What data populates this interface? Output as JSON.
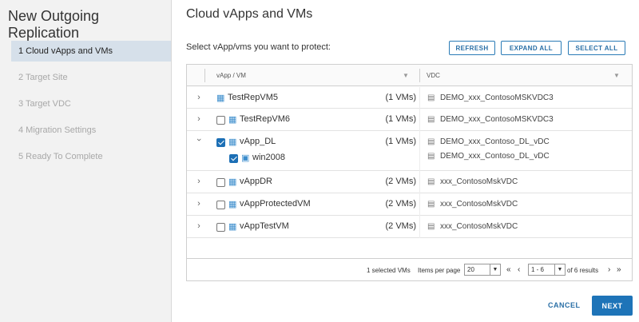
{
  "wizard": {
    "title": "New Outgoing Replication",
    "steps": [
      {
        "label": "1 Cloud vApps and VMs",
        "active": true
      },
      {
        "label": "2 Target Site",
        "active": false
      },
      {
        "label": "3 Target VDC",
        "active": false
      },
      {
        "label": "4 Migration Settings",
        "active": false
      },
      {
        "label": "5 Ready To Complete",
        "active": false
      }
    ]
  },
  "page": {
    "title": "Cloud vApps and VMs",
    "prompt": "Select vApp/vms you want to protect:",
    "buttons": {
      "refresh": "REFRESH",
      "expand_all": "EXPAND ALL",
      "select_all": "SELECT ALL"
    }
  },
  "grid": {
    "columns": {
      "vm": "vApp / VM",
      "vdc": "VDC"
    },
    "rows": [
      {
        "name": "TestRepVM5",
        "count": "(1 VMs)",
        "vdc": "DEMO_xxx_ContosoMSKVDC3",
        "expanded": false,
        "checkbox": false,
        "checked": false
      },
      {
        "name": "TestRepVM6",
        "count": "(1 VMs)",
        "vdc": "DEMO_xxx_ContosoMSKVDC3",
        "expanded": false,
        "checkbox": true,
        "checked": false
      },
      {
        "name": "vApp_DL",
        "count": "(1 VMs)",
        "vdc": "DEMO_xxx_Contoso_DL_vDC",
        "expanded": true,
        "checkbox": true,
        "checked": true,
        "children": [
          {
            "name": "win2008",
            "vdc": "DEMO_xxx_Contoso_DL_vDC",
            "checked": true
          }
        ]
      },
      {
        "name": "vAppDR",
        "count": "(2 VMs)",
        "vdc": "xxx_ContosoMskVDC",
        "expanded": false,
        "checkbox": true,
        "checked": false
      },
      {
        "name": "vAppProtectedVM",
        "count": "(2 VMs)",
        "vdc": "xxx_ContosoMskVDC",
        "expanded": false,
        "checkbox": true,
        "checked": false
      },
      {
        "name": "vAppTestVM",
        "count": "(2 VMs)",
        "vdc": "xxx_ContosoMskVDC",
        "expanded": false,
        "checkbox": true,
        "checked": false
      }
    ],
    "footer": {
      "selected": "1 selected VMs",
      "items_per_page_label": "Items per page",
      "items_per_page": "20",
      "range": "1 - 6",
      "of_results": "of 6 results"
    }
  },
  "actions": {
    "cancel": "CANCEL",
    "next": "NEXT"
  },
  "colors": {
    "accent": "#1e74b8",
    "active_step": "#d6e0ea",
    "sidebar": "#f2f2f2"
  },
  "icons": [
    "vapp-icon",
    "vm-icon",
    "vdc-icon",
    "chevron-right-icon",
    "chevron-down-icon",
    "filter-icon"
  ]
}
